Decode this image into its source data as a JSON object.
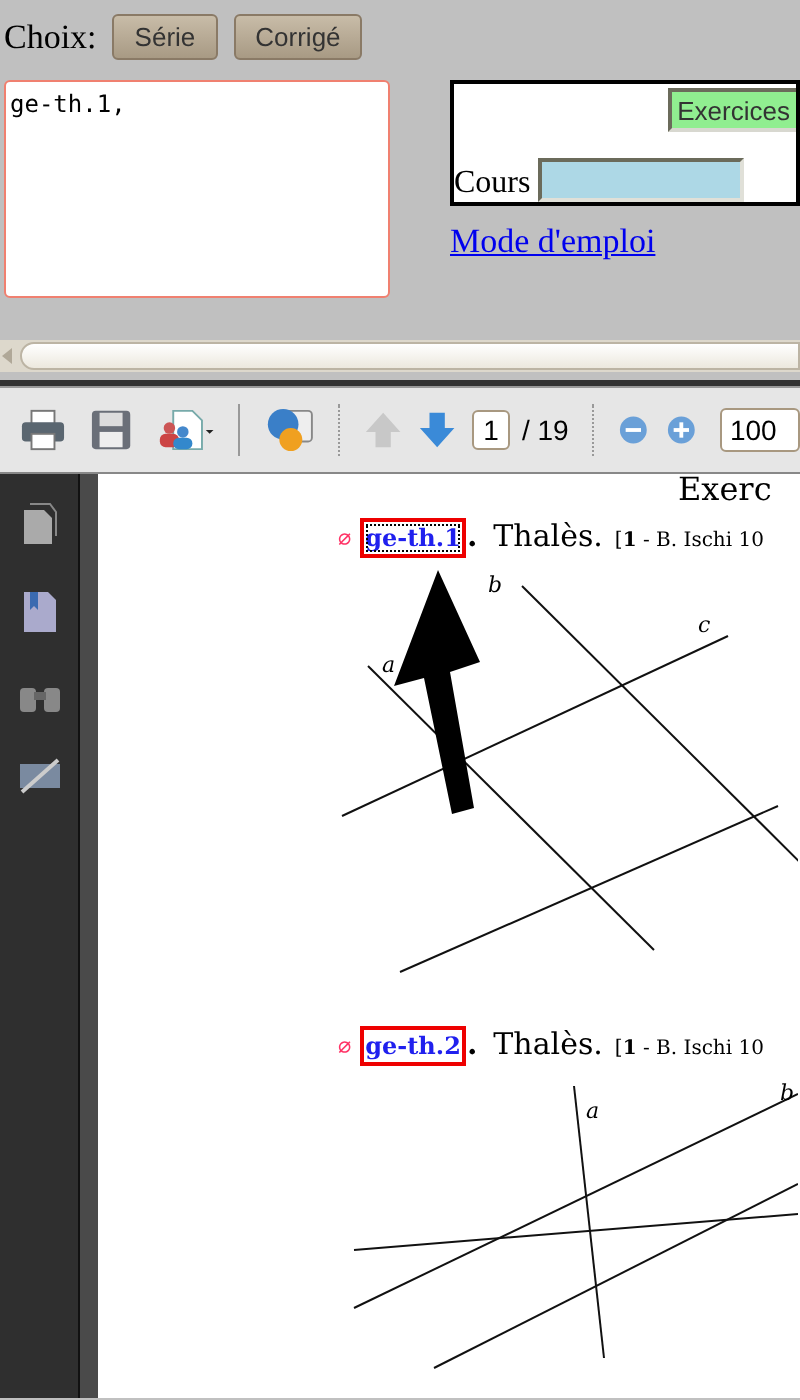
{
  "choice": {
    "label": "Choix:",
    "buttons": [
      "Série",
      "Corrigé"
    ]
  },
  "selection_box": {
    "value": "ge-th.1,"
  },
  "panel": {
    "exercises_button": "Exercices",
    "course_label": "Cours"
  },
  "help_link": "Mode d'emploi",
  "pdf_toolbar": {
    "page": "1",
    "page_count": "/ 19",
    "zoom": "100"
  },
  "pdf_page": {
    "heading": "Exerc",
    "exercises": [
      {
        "marker": "∅",
        "id": "ge-th.1",
        "dot": ".",
        "title": "Thalès.",
        "source": "[**1** - B. Ischi 10",
        "figure_labels": [
          "a",
          "b",
          "c"
        ],
        "pointed": true
      },
      {
        "marker": "∅",
        "id": "ge-th.2",
        "dot": ".",
        "title": "Thalès.",
        "source": "[**1** - B. Ischi 10",
        "figure_labels": [
          "a",
          "b"
        ],
        "pointed": false
      }
    ]
  }
}
